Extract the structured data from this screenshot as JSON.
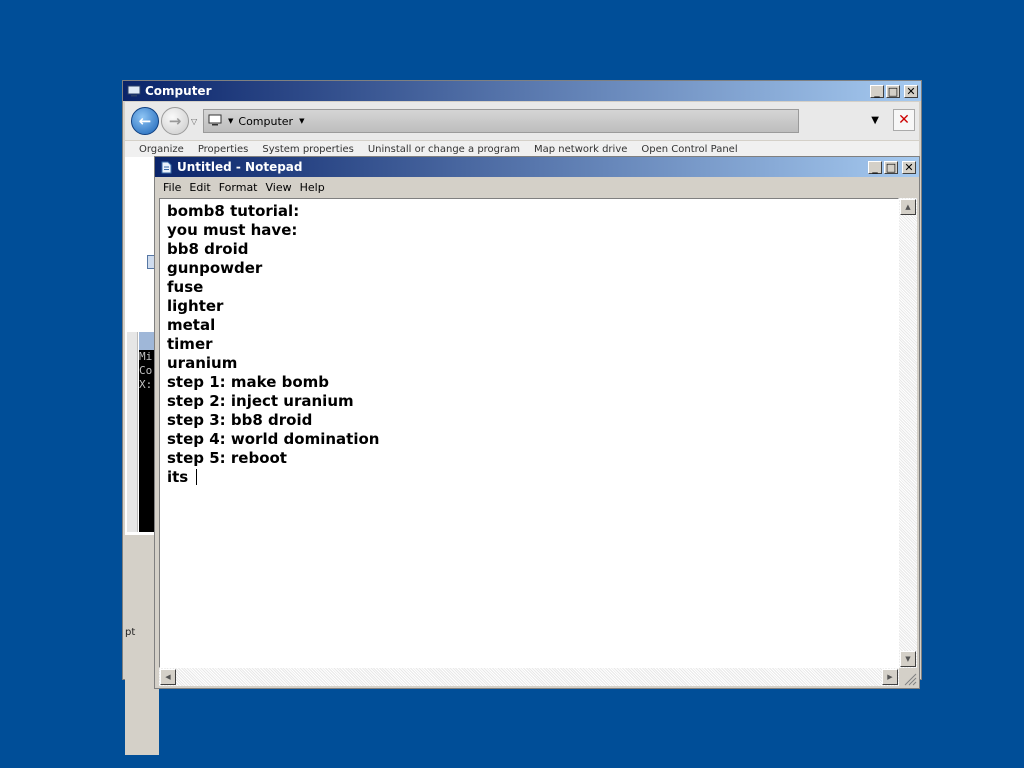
{
  "explorer": {
    "title": "Computer",
    "address_text": "Computer",
    "command_items": [
      "Organize",
      "Properties",
      "System properties",
      "Uninstall or change a program",
      "Map network drive",
      "Open Control Panel"
    ],
    "side_label": "pt",
    "console_lines": [
      "Mi",
      "Co",
      "",
      "X:"
    ]
  },
  "notepad": {
    "title": "Untitled - Notepad",
    "menu": [
      "File",
      "Edit",
      "Format",
      "View",
      "Help"
    ],
    "lines": [
      "bomb8 tutorial:",
      "you must have:",
      "bb8 droid",
      "gunpowder",
      "fuse",
      "lighter",
      "metal",
      "timer",
      "uranium",
      "step 1: make bomb",
      "step 2: inject uranium",
      "step 3: bb8 droid",
      "step 4: world domination",
      "step 5: reboot",
      "its "
    ]
  },
  "icons": {
    "computer": "computer-icon",
    "notepad": "notepad-icon",
    "back": "back-arrow-icon",
    "forward": "forward-arrow-icon",
    "stop": "stop-x-icon"
  },
  "colors": {
    "desktop": "#004e98",
    "titlebar_start": "#0a246a",
    "titlebar_end": "#a6caf0",
    "window_face": "#d4d0c8"
  }
}
